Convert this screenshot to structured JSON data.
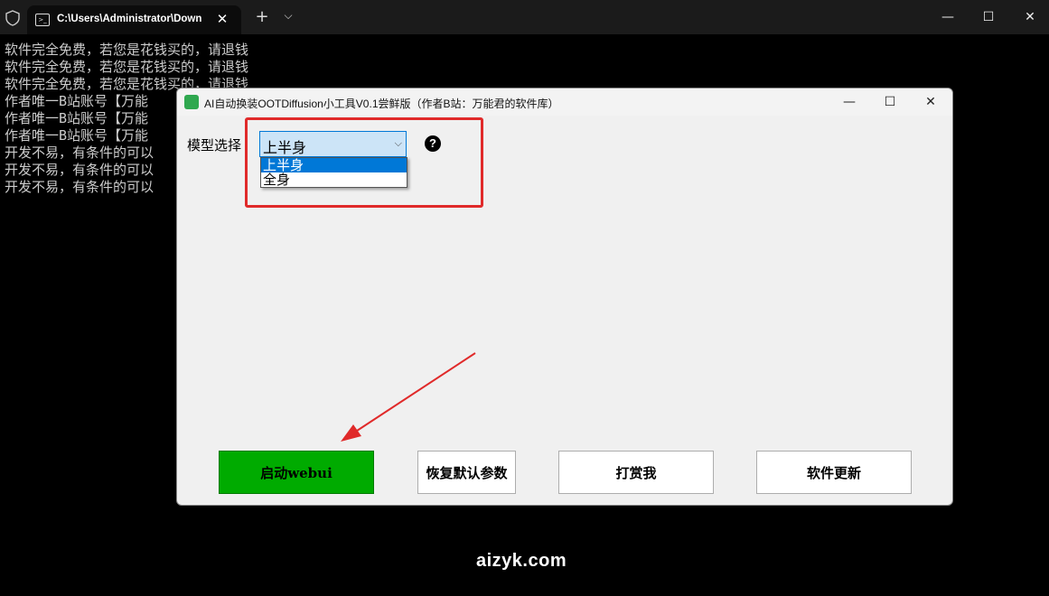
{
  "terminal": {
    "tab_title": "C:\\Users\\Administrator\\Down",
    "lines": [
      "软件完全免费，若您是花钱买的，请退钱",
      "软件完全免费，若您是花钱买的，请退钱",
      "软件完全免费，若您是花钱买的，请退钱",
      "作者唯一B站账号【万能",
      "作者唯一B站账号【万能",
      "作者唯一B站账号【万能",
      "开发不易，有条件的可以",
      "开发不易，有条件的可以",
      "开发不易，有条件的可以"
    ]
  },
  "app": {
    "title": "AI自动换装OOTDiffusion小工具V0.1尝鲜版（作者B站：万能君的软件库）",
    "model_label": "模型选择",
    "model_select": {
      "value": "上半身",
      "options": [
        "上半身",
        "全身"
      ]
    },
    "help_icon_glyph": "?",
    "buttons": {
      "start": "启动webui",
      "restore": "恢复默认参数",
      "tip": "打赏我",
      "update": "软件更新"
    }
  },
  "colors": {
    "start_button": "#00ab00",
    "highlight": "#e02a2a",
    "select_bg": "#cce4f7",
    "selected_option": "#0078d7"
  },
  "watermark": "aizyk.com"
}
